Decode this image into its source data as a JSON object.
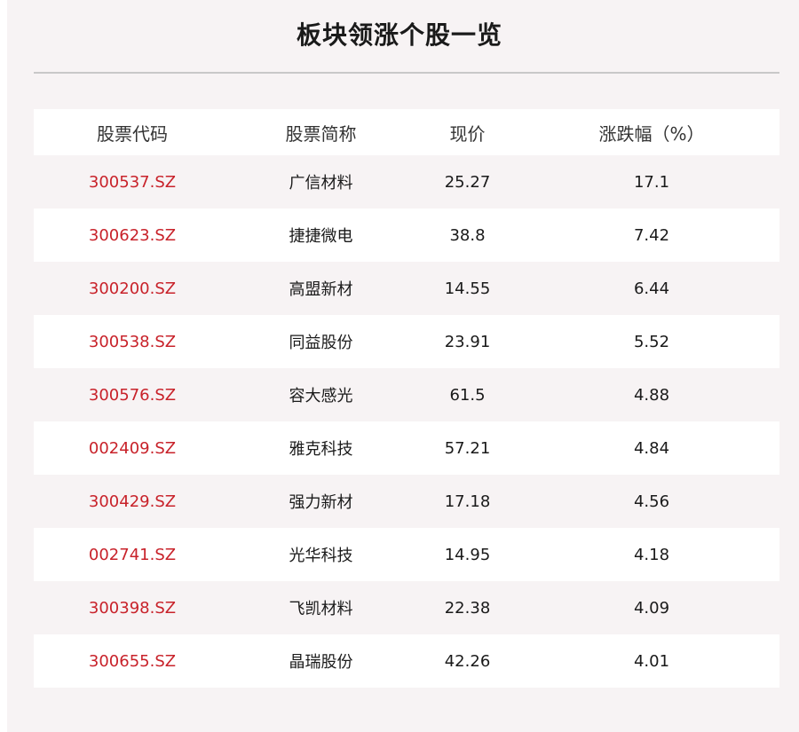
{
  "title": "板块领涨个股一览",
  "columns": [
    "股票代码",
    "股票简称",
    "现价",
    "涨跌幅（%）"
  ],
  "colors": {
    "code_text": "#c8222a",
    "background": "#f7f3f4",
    "row_alt": "#ffffff"
  },
  "rows": [
    {
      "code": "300537.SZ",
      "name": "广信材料",
      "price": "25.27",
      "change": "17.1"
    },
    {
      "code": "300623.SZ",
      "name": "捷捷微电",
      "price": "38.8",
      "change": "7.42"
    },
    {
      "code": "300200.SZ",
      "name": "高盟新材",
      "price": "14.55",
      "change": "6.44"
    },
    {
      "code": "300538.SZ",
      "name": "同益股份",
      "price": "23.91",
      "change": "5.52"
    },
    {
      "code": "300576.SZ",
      "name": "容大感光",
      "price": "61.5",
      "change": "4.88"
    },
    {
      "code": "002409.SZ",
      "name": "雅克科技",
      "price": "57.21",
      "change": "4.84"
    },
    {
      "code": "300429.SZ",
      "name": "强力新材",
      "price": "17.18",
      "change": "4.56"
    },
    {
      "code": "002741.SZ",
      "name": "光华科技",
      "price": "14.95",
      "change": "4.18"
    },
    {
      "code": "300398.SZ",
      "name": "飞凯材料",
      "price": "22.38",
      "change": "4.09"
    },
    {
      "code": "300655.SZ",
      "name": "晶瑞股份",
      "price": "42.26",
      "change": "4.01"
    }
  ]
}
